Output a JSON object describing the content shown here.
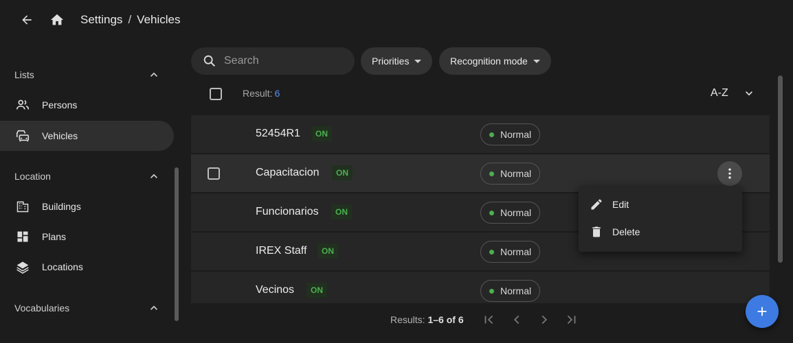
{
  "breadcrumb": {
    "root": "Settings",
    "separator": "/",
    "current": "Vehicles"
  },
  "sidebar": {
    "sections": [
      {
        "title": "Lists",
        "items": [
          {
            "label": "Persons",
            "icon": "persons-icon"
          },
          {
            "label": "Vehicles",
            "icon": "vehicle-icon",
            "active": true
          }
        ]
      },
      {
        "title": "Location",
        "items": [
          {
            "label": "Buildings",
            "icon": "building-icon"
          },
          {
            "label": "Plans",
            "icon": "plans-icon"
          },
          {
            "label": "Locations",
            "icon": "layers-icon"
          }
        ]
      },
      {
        "title": "Vocabularies",
        "items": []
      }
    ]
  },
  "toolbar": {
    "search_placeholder": "Search",
    "filter_priorities": "Priorities",
    "filter_recognition": "Recognition mode"
  },
  "list": {
    "result_label": "Result:",
    "result_count": "6",
    "sort_label": "A-Z",
    "rows": [
      {
        "name": "52454R1",
        "badge": "ON",
        "status": "Normal"
      },
      {
        "name": "Capacitacion",
        "badge": "ON",
        "status": "Normal"
      },
      {
        "name": "Funcionarios",
        "badge": "ON",
        "status": "Normal"
      },
      {
        "name": "IREX Staff",
        "badge": "ON",
        "status": "Normal"
      },
      {
        "name": "Vecinos",
        "badge": "ON",
        "status": "Normal"
      }
    ]
  },
  "context_menu": {
    "edit": "Edit",
    "delete": "Delete"
  },
  "pagination": {
    "prefix": "Results:",
    "range": "1–6 of 6"
  },
  "colors": {
    "accent": "#3d7be3",
    "on_green": "#4caf50",
    "count_blue": "#5b8dee"
  }
}
